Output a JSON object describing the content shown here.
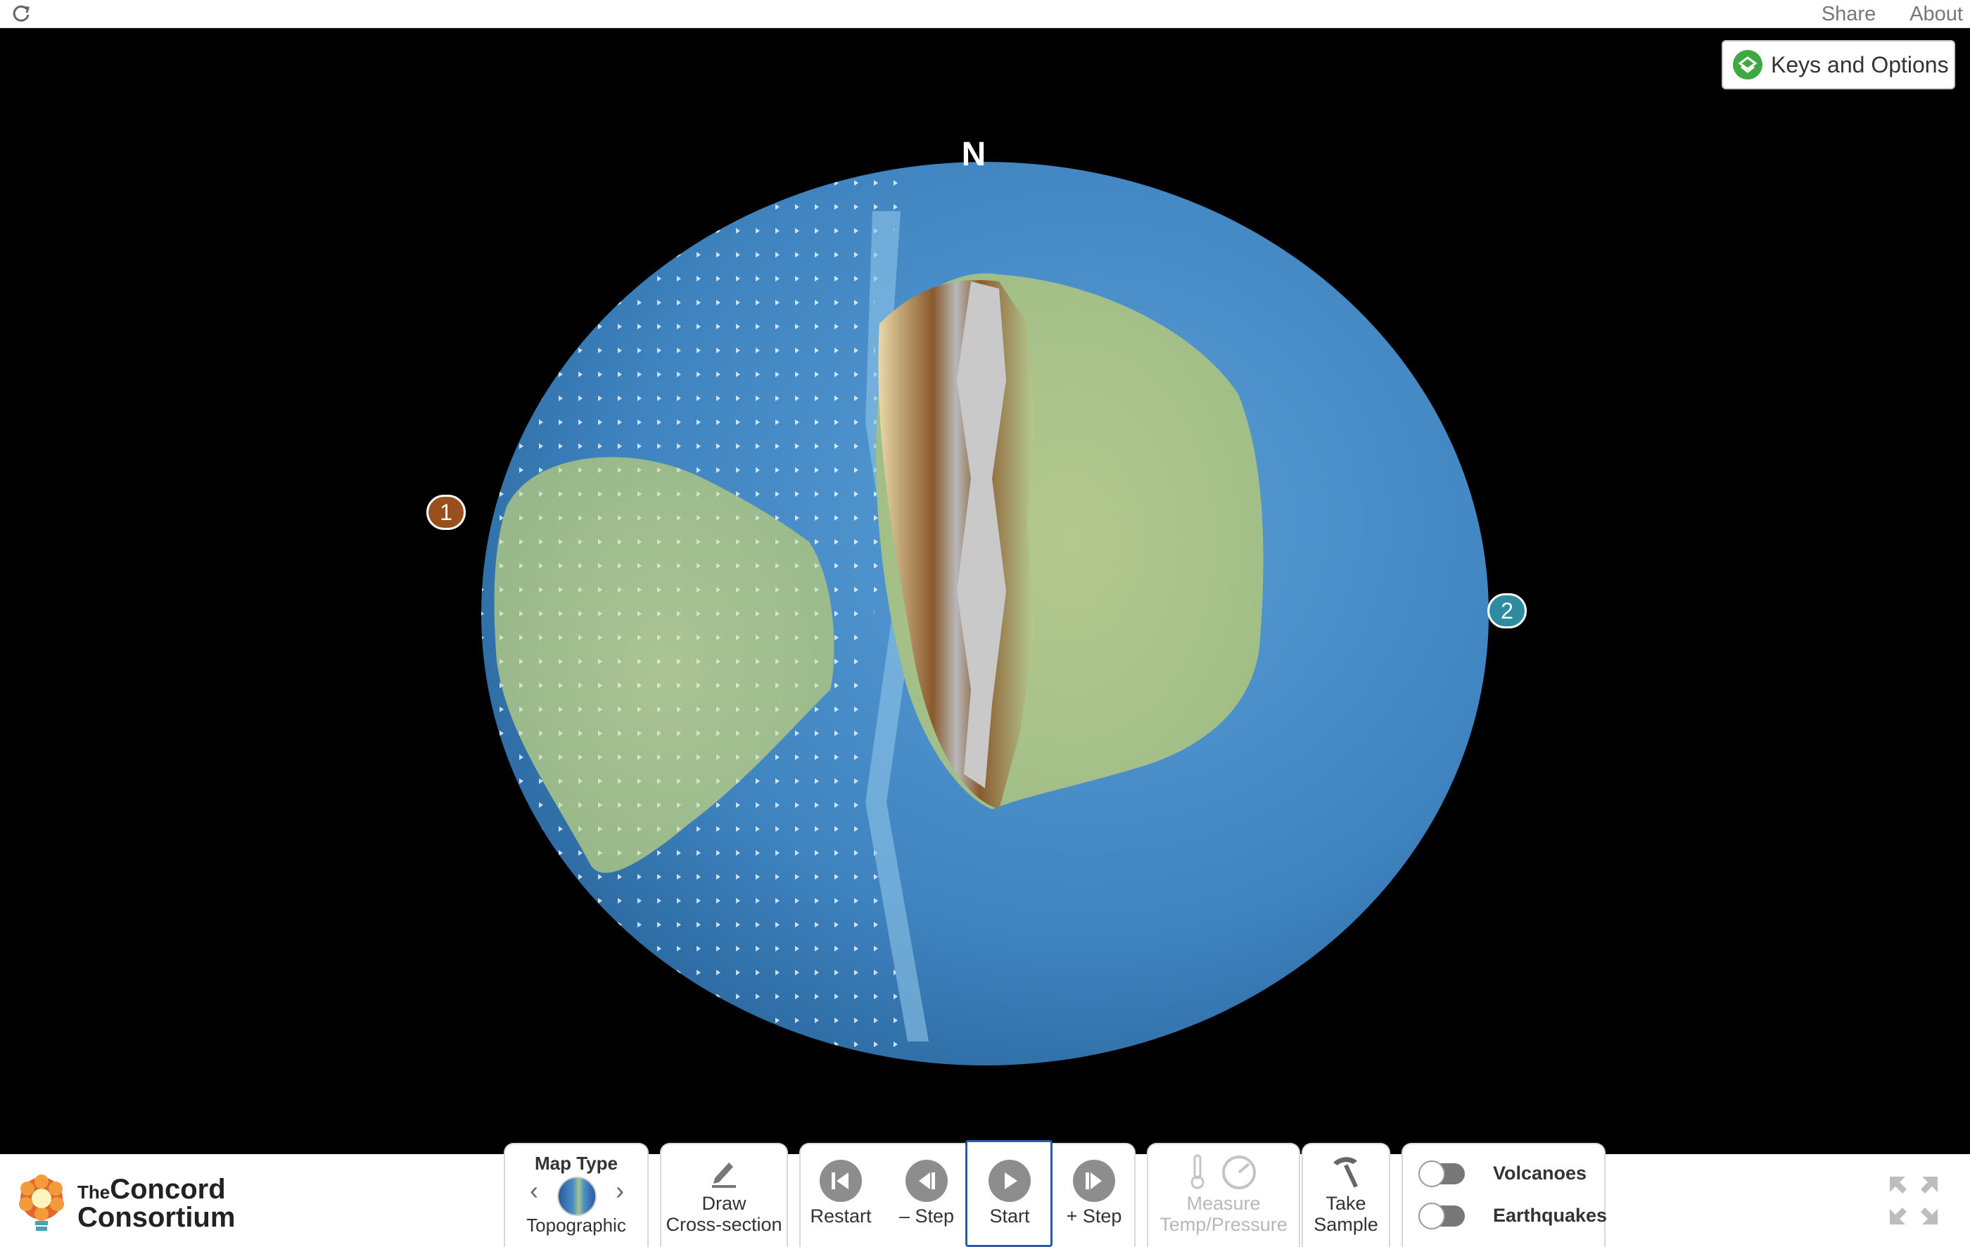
{
  "topbar": {
    "share_label": "Share",
    "about_label": "About"
  },
  "keys_button": {
    "label": "Keys and Options"
  },
  "globe": {
    "north_label": "N",
    "pin1_label": "1",
    "pin2_label": "2"
  },
  "map_type": {
    "title": "Map Type",
    "value": "Topographic"
  },
  "controls": {
    "draw_label_1": "Draw",
    "draw_label_2": "Cross-section",
    "restart_label": "Restart",
    "step_back_label": "– Step",
    "start_label": "Start",
    "step_forward_label": "+ Step",
    "measure_label_1": "Measure",
    "measure_label_2": "Temp/Pressure",
    "sample_label_1": "Take",
    "sample_label_2": "Sample"
  },
  "toggles": {
    "volcanoes_label": "Volcanoes",
    "earthquakes_label": "Earthquakes"
  },
  "logo": {
    "line1_small": "The",
    "line1": "Concord",
    "line2": "Consortium"
  },
  "colors": {
    "ocean": "#4a8fc8",
    "land": "#a9c48c",
    "plate1": "#9a4f1e",
    "plate2": "#2f8ca0",
    "start_border": "#2a5aa8"
  }
}
